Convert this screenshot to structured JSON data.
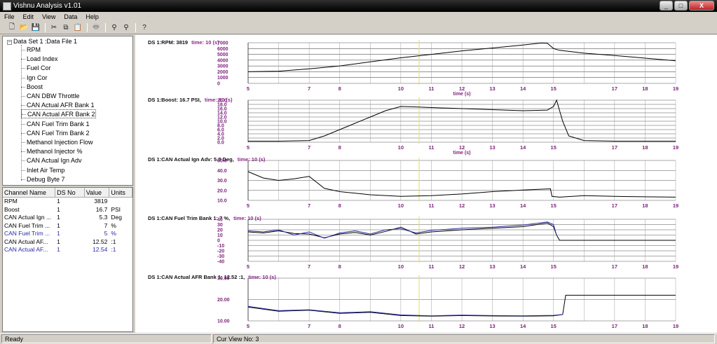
{
  "window": {
    "title": "Vishnu Analysis v1.01",
    "controls": [
      "_",
      "□",
      "X"
    ]
  },
  "menu": [
    "File",
    "Edit",
    "View",
    "Data",
    "Help"
  ],
  "toolbar_icons": [
    "new-icon",
    "open-icon",
    "save-icon",
    "cut-icon",
    "copy-icon",
    "paste-icon",
    "print-icon",
    "zoom-in-icon",
    "zoom-out-icon",
    "help-icon"
  ],
  "tree": {
    "root": "Data Set 1 :Data File 1",
    "items": [
      "RPM",
      "Load Index",
      "Fuel Cor",
      "Ign Cor",
      "Boost",
      "CAN DBW Throttle",
      "CAN Actual AFR Bank 1",
      "CAN Actual AFR Bank 2",
      "CAN Fuel Trim Bank 1",
      "CAN Fuel Trim Bank 2",
      "Methanol Injection Flow",
      "Methanol Injector %",
      "CAN Actual Ign Adv",
      "Inlet Air Temp",
      "Debug Byte 7"
    ],
    "selected_index": 7
  },
  "channel_table": {
    "headers": [
      "Channel Name",
      "DS No",
      "Value",
      "Units"
    ],
    "rows": [
      {
        "name": "RPM",
        "ds": "1",
        "value": "3819",
        "units": "",
        "color": "#000000"
      },
      {
        "name": "Boost",
        "ds": "1",
        "value": "16.7",
        "units": "PSI",
        "color": "#000000"
      },
      {
        "name": "CAN Actual Ign ...",
        "ds": "1",
        "value": "5.3",
        "units": "Deg",
        "color": "#000000"
      },
      {
        "name": "CAN Fuel Trim ...",
        "ds": "1",
        "value": "7",
        "units": "%",
        "color": "#000000"
      },
      {
        "name": "CAN Fuel Trim ...",
        "ds": "1",
        "value": "5",
        "units": "%",
        "color": "#2a2aa8"
      },
      {
        "name": "CAN Actual AF...",
        "ds": "1",
        "value": "12.52",
        "units": ":1",
        "color": "#000000"
      },
      {
        "name": "CAN Actual AF...",
        "ds": "1",
        "value": "12.54",
        "units": ":1",
        "color": "#2a2aa8"
      }
    ]
  },
  "status": {
    "left": "Ready",
    "view": "Cur View No: 3"
  },
  "cursor_time": 10.6,
  "chart_data": [
    {
      "type": "line",
      "title": "DS 1:RPM: 3819",
      "title_time": "time: 10 (s)",
      "xlabel": "time (s)",
      "x_range": [
        5,
        19
      ],
      "ylim": [
        0,
        7000
      ],
      "yticks": [
        "7000",
        "6000",
        "5000",
        "4000",
        "3000",
        "2000",
        "1000",
        "0"
      ],
      "series": [
        {
          "color": "#000000",
          "x": [
            5,
            6,
            7,
            8,
            9,
            10,
            11,
            12,
            13,
            14,
            14.6,
            14.8,
            15,
            15.2,
            16,
            17,
            18,
            19
          ],
          "y": [
            2000,
            2100,
            2500,
            3000,
            3700,
            4400,
            5000,
            5600,
            6100,
            6600,
            6950,
            6900,
            6000,
            5700,
            5200,
            4800,
            4350,
            3900
          ]
        }
      ]
    },
    {
      "type": "line",
      "title": "DS 1:Boost: 16.7  PSI,",
      "title_time": "time: 10 (s)",
      "xlabel": "time (s)",
      "x_range": [
        5,
        19
      ],
      "ylim": [
        0,
        20
      ],
      "yticks": [
        "20.0",
        "18.0",
        "16.0",
        "14.0",
        "12.0",
        "10.0",
        "8.0",
        "6.0",
        "4.0",
        "2.0",
        "0.0"
      ],
      "series": [
        {
          "color": "#000000",
          "x": [
            5,
            6,
            7,
            7.5,
            8,
            8.5,
            9,
            9.5,
            10,
            10.5,
            11,
            12,
            13,
            14,
            14.8,
            15,
            15.1,
            15.3,
            15.5,
            16,
            17,
            19
          ],
          "y": [
            0.5,
            0.5,
            0.8,
            3,
            6,
            9,
            12,
            15,
            17,
            16.8,
            16.5,
            16,
            15.5,
            15,
            15.3,
            17,
            20,
            10,
            3,
            0.8,
            0.5,
            0.5
          ]
        }
      ]
    },
    {
      "type": "line",
      "title": "DS 1:CAN Actual Ign Adv: 5.3  Deg,",
      "title_time": "time: 10 (s)",
      "xlabel": "",
      "x_range": [
        5,
        19
      ],
      "ylim": [
        0,
        50
      ],
      "yticks": [
        "50.0",
        "40.0",
        "30.0",
        "20.0",
        "10.0"
      ],
      "series": [
        {
          "color": "#000000",
          "x": [
            5,
            5.5,
            6,
            6.5,
            7,
            7.5,
            8,
            9,
            10,
            11,
            12,
            13,
            14,
            14.9,
            14.95,
            15.2,
            16,
            17,
            18,
            19
          ],
          "y": [
            36,
            28,
            25,
            27,
            30,
            15,
            11,
            7,
            5,
            6,
            8,
            11,
            13,
            14.5,
            5,
            4,
            6,
            5,
            4.5,
            4
          ]
        }
      ]
    },
    {
      "type": "line",
      "title": "DS 1:CAN Fuel Trim Bank 1: 7  %,",
      "title_time": "time: 10 (s)",
      "xlabel": "",
      "x_range": [
        5,
        19
      ],
      "ylim": [
        -40,
        40
      ],
      "yticks": [
        "40",
        "30",
        "20",
        "10",
        "0",
        "-10",
        "-20",
        "-30",
        "-40"
      ],
      "series": [
        {
          "name": "CAN Fuel Trim Bank 1",
          "color": "#000000",
          "x": [
            5,
            5.5,
            6,
            6.5,
            7,
            7.5,
            8,
            8.5,
            9,
            9.5,
            10,
            10.5,
            11,
            12,
            13,
            14,
            14.8,
            15,
            15.1,
            15.2,
            19
          ],
          "y": [
            16,
            14,
            18,
            13,
            12,
            5,
            12,
            15,
            10,
            17,
            25,
            12,
            16,
            20,
            23,
            26,
            33,
            26,
            10,
            0,
            0
          ]
        },
        {
          "name": "CAN Fuel Trim Bank 2",
          "color": "#2a2aa8",
          "x": [
            5,
            5.5,
            6,
            6.5,
            7,
            7.5,
            8,
            8.5,
            9,
            9.5,
            10,
            10.5,
            11,
            12,
            13,
            14,
            14.8,
            15,
            15.1
          ],
          "y": [
            18,
            16,
            20,
            10,
            16,
            4,
            14,
            18,
            12,
            20,
            22,
            14,
            19,
            23,
            25,
            29,
            35,
            30,
            10
          ]
        }
      ]
    },
    {
      "type": "line",
      "title": "DS 1:CAN Actual AFR Bank 1: 12.52  :1,",
      "title_time": "time: 10 (s)",
      "xlabel": "",
      "x_range": [
        5,
        19
      ],
      "ylim": [
        10,
        30
      ],
      "yticks": [
        "30.00",
        "20.00",
        "10.00"
      ],
      "series": [
        {
          "name": "CAN Actual AFR Bank 1",
          "color": "#000000",
          "x": [
            5,
            6,
            7,
            8,
            9,
            10,
            11,
            12,
            13,
            14,
            15,
            15.3,
            15.4,
            19
          ],
          "y": [
            16.5,
            14.5,
            15,
            13.5,
            14,
            12.5,
            12.2,
            12.5,
            12.3,
            12.2,
            12.4,
            13,
            22,
            22
          ]
        },
        {
          "name": "CAN Actual AFR Bank 2",
          "color": "#2a2aa8",
          "x": [
            5,
            6,
            7,
            8,
            9,
            10,
            11,
            12,
            13,
            14,
            15,
            15.3
          ],
          "y": [
            16.8,
            14.8,
            15.2,
            13.8,
            14.3,
            12.8,
            12.4,
            12.7,
            12.5,
            12.4,
            12.6,
            13
          ]
        }
      ]
    }
  ]
}
